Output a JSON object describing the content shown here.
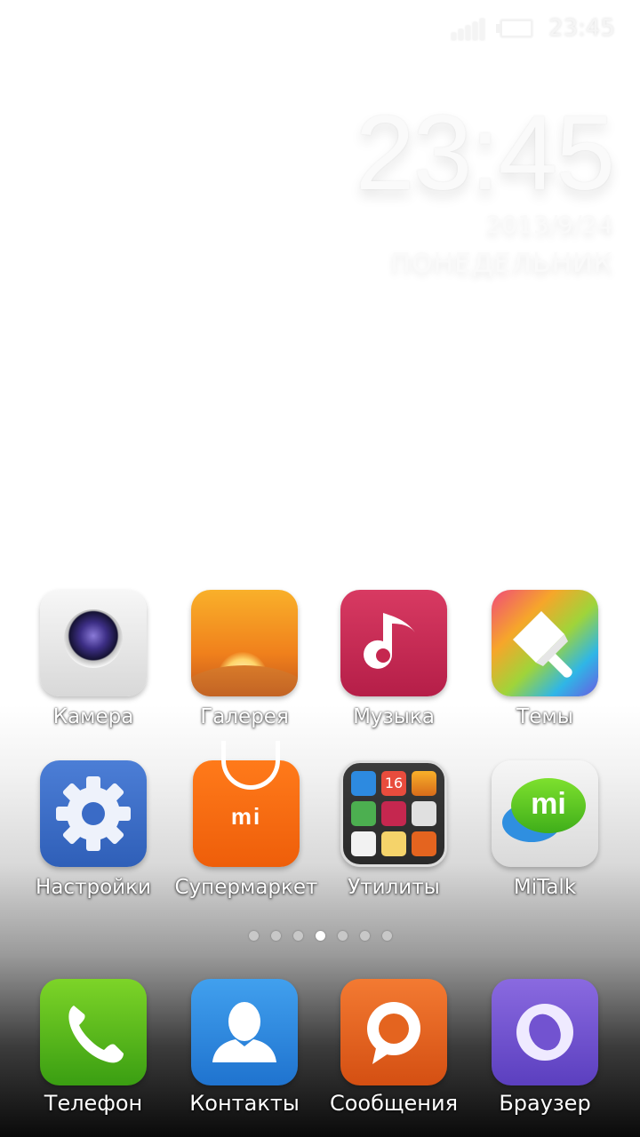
{
  "status_bar": {
    "time": "23:45",
    "signal_icon": "signal-icon",
    "battery_icon": "battery-icon"
  },
  "clock_widget": {
    "time": "23:45",
    "date": "2013/9/24",
    "weekday": "ПОНЕДЕЛЬНИК"
  },
  "apps": [
    {
      "label": "Камера",
      "icon": "camera-icon"
    },
    {
      "label": "Галерея",
      "icon": "gallery-icon"
    },
    {
      "label": "Музыка",
      "icon": "music-icon"
    },
    {
      "label": "Темы",
      "icon": "themes-icon"
    },
    {
      "label": "Настройки",
      "icon": "settings-icon"
    },
    {
      "label": "Супермаркет",
      "icon": "supermarket-icon",
      "badge": "mi"
    },
    {
      "label": "Утилиты",
      "icon": "utilities-folder-icon",
      "folder_badge": "16"
    },
    {
      "label": "MiTalk",
      "icon": "mitalk-icon",
      "badge": "mi"
    }
  ],
  "page_indicator": {
    "pages": 7,
    "current": 4
  },
  "dock": [
    {
      "label": "Телефон",
      "icon": "phone-icon"
    },
    {
      "label": "Контакты",
      "icon": "contacts-icon"
    },
    {
      "label": "Сообщения",
      "icon": "messages-icon"
    },
    {
      "label": "Браузер",
      "icon": "browser-icon"
    }
  ],
  "colors": {
    "camera_lens": "#3d2f86",
    "gallery": "#f0801c",
    "music": "#c5274f",
    "settings": "#3a6bc6",
    "supermarket": "#f26a12",
    "mitalk_green": "#5cc62a",
    "phone": "#5cbc1c",
    "contacts": "#2f88df",
    "messages": "#e4641f",
    "browser": "#7253d0"
  }
}
